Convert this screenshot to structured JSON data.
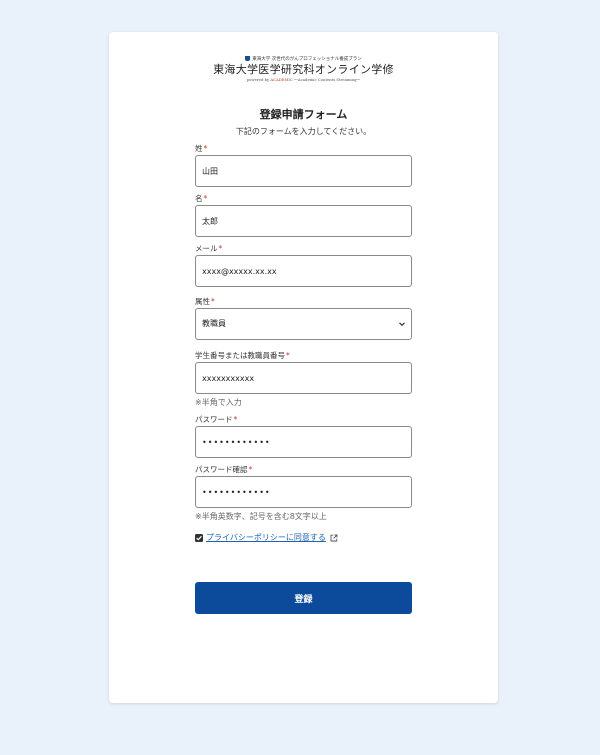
{
  "logo": {
    "top_line": "東海大学 次世代のがんプロフェッショナル養成プラン",
    "main": "東海大学医学研究科オンライン学修",
    "sub_prefix": "powered by",
    "sub_accent": "ACADEMIC",
    "sub_suffix": "～Academic Contents Streaming～"
  },
  "form": {
    "title": "登録申請フォーム",
    "subtitle": "下記のフォームを入力してください。",
    "fields": {
      "last_name": {
        "label": "姓",
        "value": "山田"
      },
      "first_name": {
        "label": "名",
        "value": "太郎"
      },
      "email": {
        "label": "メール",
        "value": "xxxx@xxxxx.xx.xx"
      },
      "attribute": {
        "label": "属性",
        "selected": "教職員"
      },
      "id_number": {
        "label": "学生番号または教職員番号",
        "value": "xxxxxxxxxxx",
        "hint": "※半角で入力"
      },
      "password": {
        "label": "パスワード",
        "value": "••••••••••••"
      },
      "password_confirm": {
        "label": "パスワード確認",
        "value": "••••••••••••",
        "hint": "※半角英数字、記号を含む8文字以上"
      }
    },
    "required_mark": "*",
    "consent": {
      "label": "プライバシーポリシーに同意する",
      "checked": true
    },
    "submit_label": "登録"
  },
  "colors": {
    "background": "#e9f1fa",
    "primary": "#0c4a9c",
    "required": "#d0312d",
    "link": "#1e63b5"
  },
  "icons": {
    "logo": "shield-icon",
    "select": "chevron-down-icon",
    "checkbox": "checkmark-icon",
    "link": "external-link-icon"
  }
}
